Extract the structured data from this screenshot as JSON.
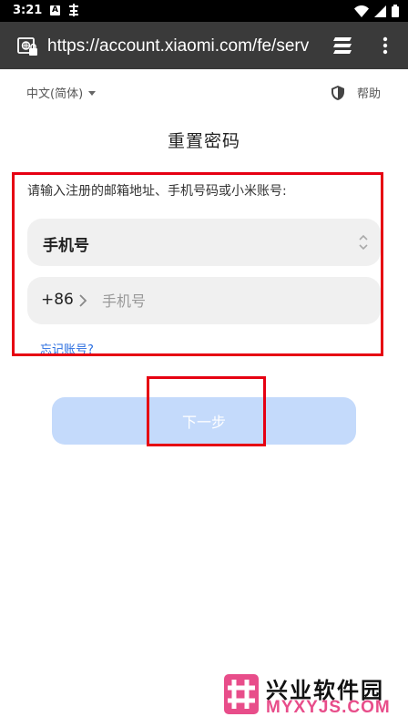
{
  "status_bar": {
    "time": "3:21",
    "notification_a": "A"
  },
  "browser": {
    "url": "https://account.xiaomi.com/fe/serv"
  },
  "page": {
    "language": "中文(简体)",
    "help": "帮助",
    "title": "重置密码",
    "instruction": "请输入注册的邮箱地址、手机号码或小米账号:",
    "account_type": "手机号",
    "country_code": "+86",
    "phone_placeholder": "手机号",
    "forgot_account": "忘记账号?",
    "next_button": "下一步"
  },
  "watermark": {
    "title": "兴业软件园",
    "subtitle": "MYXYJS.COM"
  },
  "colors": {
    "highlight": "#e60012",
    "link": "#2a6ee0",
    "button_disabled": "#c4dafb"
  }
}
